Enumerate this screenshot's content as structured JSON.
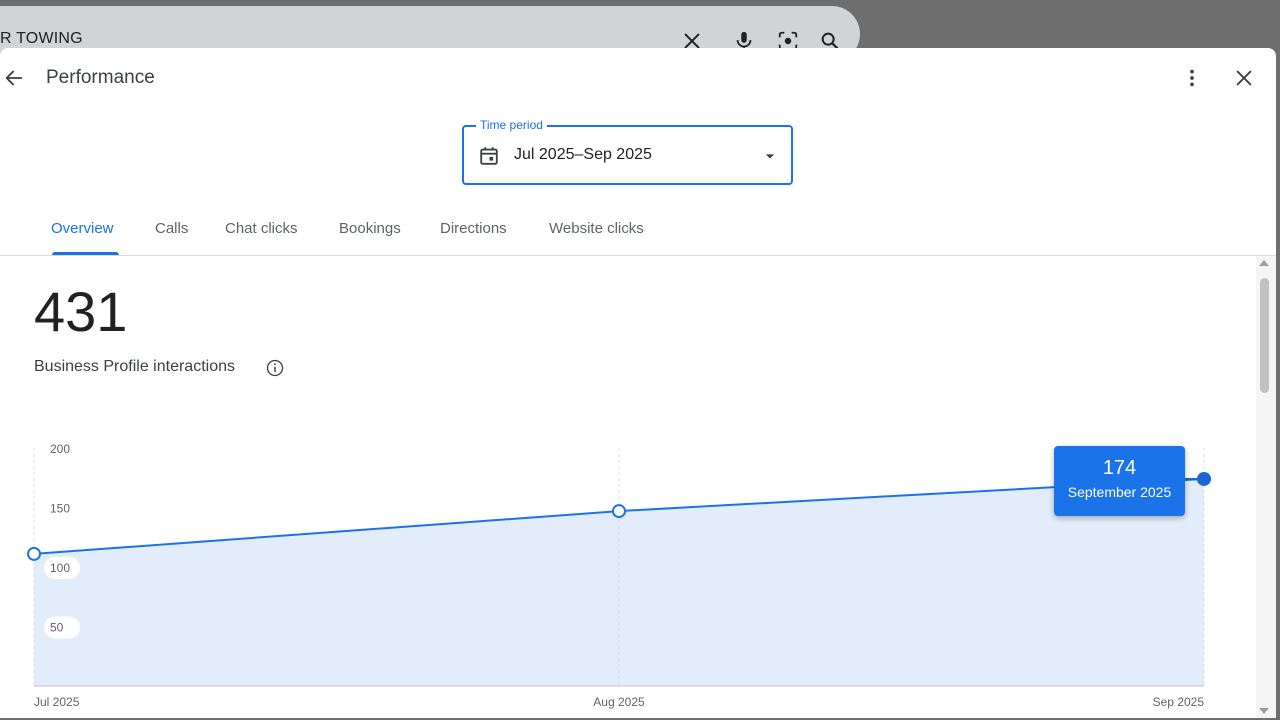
{
  "background_search": {
    "query": "R TOWING"
  },
  "header": {
    "title": "Performance"
  },
  "time_period": {
    "label": "Time period",
    "value": "Jul 2025–Sep 2025"
  },
  "tabs": [
    {
      "label": "Overview",
      "active": true
    },
    {
      "label": "Calls",
      "active": false
    },
    {
      "label": "Chat clicks",
      "active": false
    },
    {
      "label": "Bookings",
      "active": false
    },
    {
      "label": "Directions",
      "active": false
    },
    {
      "label": "Website clicks",
      "active": false
    }
  ],
  "summary": {
    "total": "431",
    "label": "Business Profile interactions"
  },
  "tooltip": {
    "value": "174",
    "date": "September 2025"
  },
  "colors": {
    "accent": "#1a73e8",
    "area_fill": "#e3ecfb",
    "selected_point": "#1967d2"
  },
  "icons": [
    "close-icon",
    "mic-icon",
    "lens-icon",
    "search-icon",
    "back-arrow-icon",
    "more-vert-icon",
    "calendar-icon",
    "dropdown-arrow-icon",
    "info-icon"
  ],
  "chart_data": {
    "type": "area",
    "categories": [
      "Jul 2025",
      "Aug 2025",
      "Sep 2025"
    ],
    "values": [
      111,
      147,
      174
    ],
    "selected_index": 2,
    "yticks": [
      200,
      150,
      100,
      50
    ],
    "ylim": [
      0,
      200
    ],
    "grid": "vertical dashed"
  }
}
